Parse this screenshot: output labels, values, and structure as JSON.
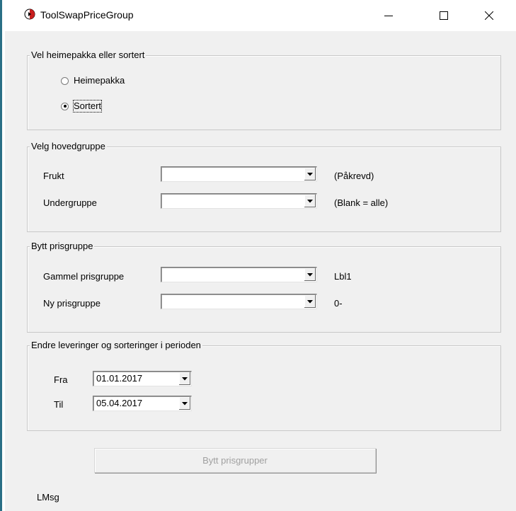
{
  "window": {
    "title": "ToolSwapPriceGroup",
    "icons": [
      "app-icon",
      "minimize-icon",
      "maximize-icon",
      "close-icon"
    ]
  },
  "group_type": {
    "title": "Vel heimepakka eller sortert",
    "options": [
      {
        "label": "Heimepakka",
        "checked": false
      },
      {
        "label": "Sortert",
        "checked": true
      }
    ]
  },
  "group_main": {
    "title": "Velg hovedgruppe",
    "frukt_label": "Frukt",
    "frukt_value": "",
    "frukt_hint": "(Påkrevd)",
    "undergruppe_label": "Undergruppe",
    "undergruppe_value": "",
    "undergruppe_hint": "(Blank = alle)"
  },
  "group_price": {
    "title": "Bytt prisgruppe",
    "old_label": "Gammel prisgruppe",
    "old_value": "",
    "old_hint": "Lbl1",
    "new_label": "Ny prisgruppe",
    "new_value": "",
    "new_hint": "0-"
  },
  "group_period": {
    "title": "Endre leveringer og sorteringer i perioden",
    "fra_label": "Fra",
    "fra_value": "01.01.2017",
    "til_label": "Til",
    "til_value": "05.04.2017"
  },
  "actions": {
    "swap_button": "Bytt prisgrupper",
    "swap_button_enabled": false
  },
  "status": {
    "message": "LMsg"
  },
  "colors": {
    "client_bg": "#f0f0f0",
    "window_bg": "#ffffff",
    "left_accent": "#2a6f86",
    "disabled_text": "#a0a0a0"
  }
}
